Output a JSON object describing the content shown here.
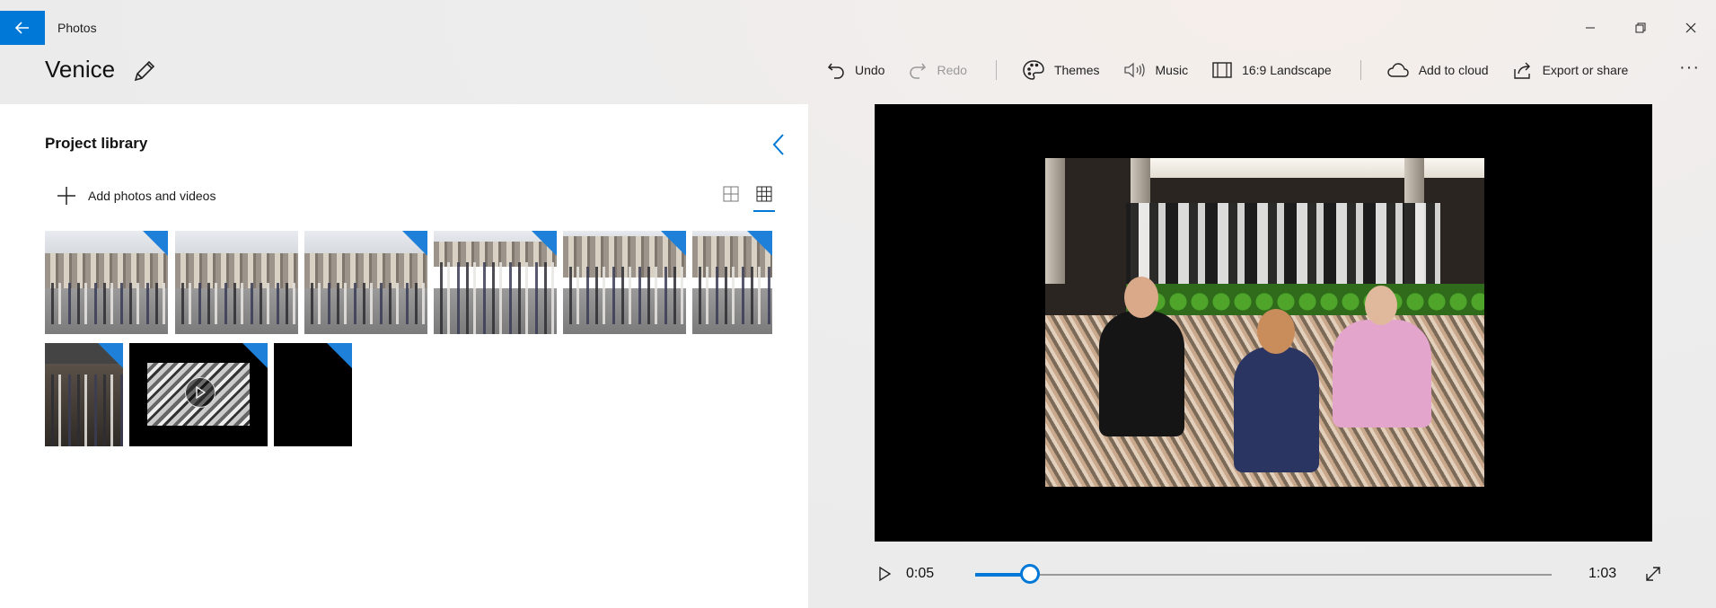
{
  "window": {
    "app_title": "Photos",
    "controls": [
      "minimize-icon",
      "restore-icon",
      "close-icon"
    ]
  },
  "project": {
    "title": "Venice"
  },
  "toolbar": {
    "undo": "Undo",
    "redo": "Redo",
    "themes": "Themes",
    "music": "Music",
    "aspect": "16:9 Landscape",
    "cloud": "Add to cloud",
    "export": "Export or share",
    "more": "···"
  },
  "library": {
    "title": "Project library",
    "add_label": "Add photos and videos",
    "view_mode": "small-grid"
  },
  "player": {
    "current_time": "0:05",
    "total_time": "1:03",
    "progress": 0.095
  },
  "colors": {
    "accent": "#0078d7",
    "badge": "#1e80d9"
  }
}
